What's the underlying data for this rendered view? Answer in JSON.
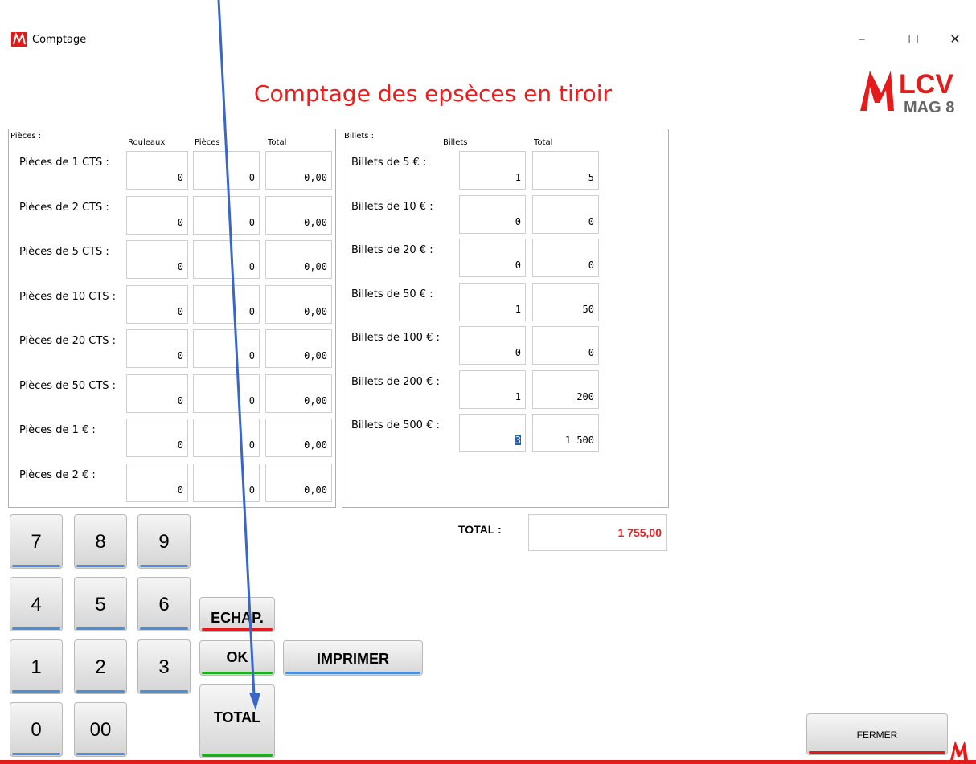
{
  "window": {
    "title": "Comptage",
    "minimize": "–",
    "maximize": "☐",
    "close": "✕"
  },
  "heading": "Comptage des epsèces en tiroir",
  "logo": {
    "brand": "LCV",
    "sub": "MAG 8"
  },
  "pieces": {
    "group_label": "Pièces :",
    "col_rouleaux": "Rouleaux",
    "col_pieces": "Pièces",
    "col_total": "Total",
    "rows": [
      {
        "label": "Pièces de 1 CTS :",
        "rouleaux": "0",
        "pieces": "0",
        "total": "0,00"
      },
      {
        "label": "Pièces de 2 CTS :",
        "rouleaux": "0",
        "pieces": "0",
        "total": "0,00"
      },
      {
        "label": "Pièces de 5 CTS :",
        "rouleaux": "0",
        "pieces": "0",
        "total": "0,00"
      },
      {
        "label": "Pièces de 10 CTS :",
        "rouleaux": "0",
        "pieces": "0",
        "total": "0,00"
      },
      {
        "label": "Pièces de 20 CTS :",
        "rouleaux": "0",
        "pieces": "0",
        "total": "0,00"
      },
      {
        "label": "Pièces de 50 CTS :",
        "rouleaux": "0",
        "pieces": "0",
        "total": "0,00"
      },
      {
        "label": "Pièces de 1 € :",
        "rouleaux": "0",
        "pieces": "0",
        "total": "0,00"
      },
      {
        "label": "Pièces de 2 € :",
        "rouleaux": "0",
        "pieces": "0",
        "total": "0,00"
      }
    ]
  },
  "billets": {
    "group_label": "Billets :",
    "col_billets": "Billets",
    "col_total": "Total",
    "rows": [
      {
        "label": "Billets de 5 € :",
        "billets": "1",
        "total": "5"
      },
      {
        "label": "Billets de 10 € :",
        "billets": "0",
        "total": "0"
      },
      {
        "label": "Billets de 20 € :",
        "billets": "0",
        "total": "0"
      },
      {
        "label": "Billets de 50 € :",
        "billets": "1",
        "total": "50"
      },
      {
        "label": "Billets de 100 € :",
        "billets": "0",
        "total": "0"
      },
      {
        "label": "Billets de 200 € :",
        "billets": "1",
        "total": "200"
      },
      {
        "label": "Billets de 500 € :",
        "billets": "3",
        "total": "1 500"
      }
    ]
  },
  "grand_total": {
    "label": "TOTAL :",
    "value": "1 755,00"
  },
  "keypad": {
    "k7": "7",
    "k8": "8",
    "k9": "9",
    "k4": "4",
    "k5": "5",
    "k6": "6",
    "k1": "1",
    "k2": "2",
    "k3": "3",
    "k0": "0",
    "k00": "00"
  },
  "buttons": {
    "echap": "ECHAP.",
    "ok": "OK",
    "imprimer": "IMPRIMER",
    "total": "TOTAL",
    "fermer": "FERMER"
  },
  "colors": {
    "accent_red": "#e41b1b",
    "key_underline_blue": "#4a90d9",
    "ok_green": "#22aa22",
    "arrow_blue": "#3a66c4"
  }
}
